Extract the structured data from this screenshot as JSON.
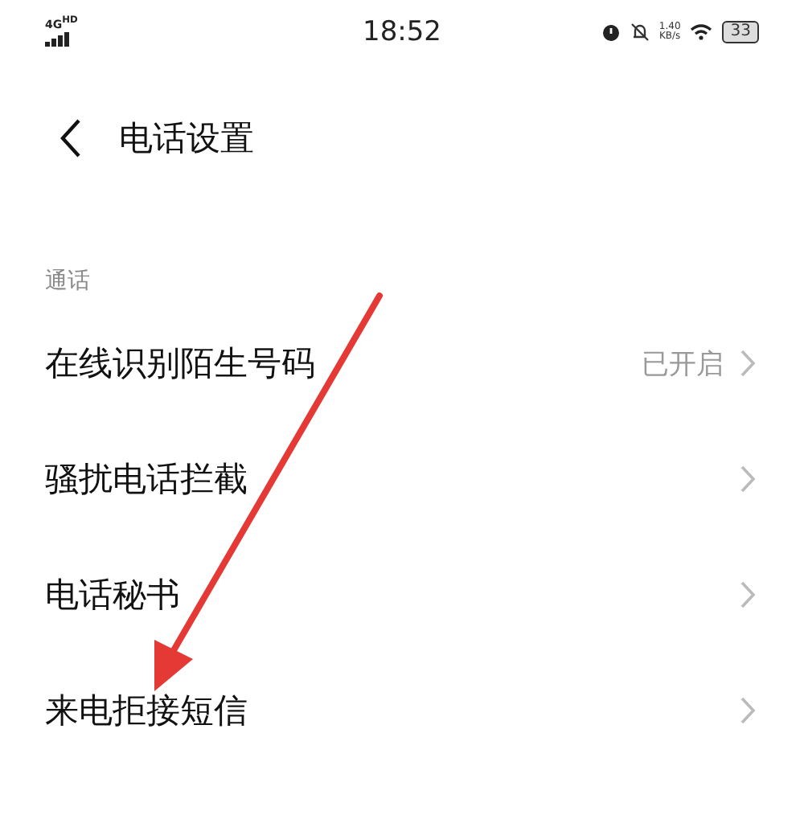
{
  "status_bar": {
    "network": "4G",
    "network_badge": "HD",
    "time": "18:52",
    "speed": "1.40",
    "speed_unit": "KB/s",
    "battery": "33"
  },
  "header": {
    "title": "电话设置"
  },
  "section": {
    "label": "通话"
  },
  "rows": [
    {
      "label": "在线识别陌生号码",
      "value": "已开启"
    },
    {
      "label": "骚扰电话拦截"
    },
    {
      "label": "电话秘书"
    },
    {
      "label": "来电拒接短信"
    }
  ]
}
